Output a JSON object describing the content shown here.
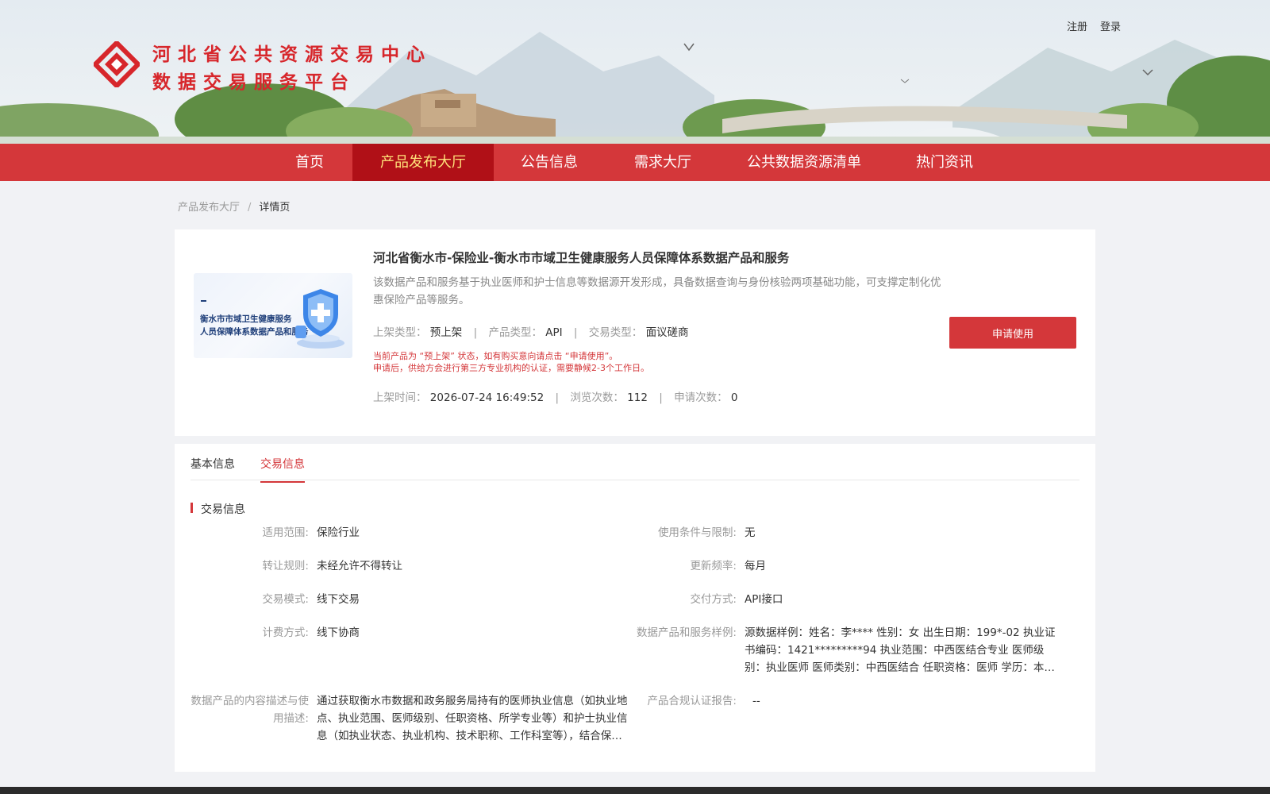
{
  "header": {
    "title_line1": "河北省公共资源交易中心",
    "title_line2": "数据交易服务平台",
    "register": "注册",
    "login": "登录",
    "colors": {
      "brand_red": "#d7262b"
    }
  },
  "nav": {
    "items": [
      {
        "label": "首页"
      },
      {
        "label": "产品发布大厅",
        "active": true
      },
      {
        "label": "公告信息"
      },
      {
        "label": "需求大厅"
      },
      {
        "label": "公共数据资源清单"
      },
      {
        "label": "热门资讯"
      }
    ]
  },
  "breadcrumb": {
    "parent": "产品发布大厅",
    "separator": "/",
    "current": "详情页"
  },
  "product": {
    "image_text_line1": "衡水市市域卫生健康服务",
    "image_text_line2": "人员保障体系数据产品和服务",
    "title": "河北省衡水市-保险业-衡水市市域卫生健康服务人员保障体系数据产品和服务",
    "description": "该数据产品和服务基于执业医师和护士信息等数据源开发形成，具备数据查询与身份核验两项基础功能，可支撑定制化优惠保险产品等服务。",
    "meta": {
      "listing_type_label": "上架类型：",
      "listing_type": "预上架",
      "product_type_label": "产品类型：",
      "product_type": "API",
      "trade_type_label": "交易类型：",
      "trade_type": "面议磋商"
    },
    "notice_line1": "当前产品为 “预上架” 状态，如有购买意向请点击 “申请使用”。",
    "notice_line2": "申请后，供给方会进行第三方专业机构的认证，需要静候2-3个工作日。",
    "stats": {
      "listed_time_label": "上架时间：",
      "listed_time": "2026-07-24 16:49:52",
      "views_label": "浏览次数：",
      "views": "112",
      "applications_label": "申请次数：",
      "applications": "0"
    },
    "apply_button": "申请使用",
    "separator": "|"
  },
  "detail": {
    "tabs": [
      {
        "label": "基本信息"
      },
      {
        "label": "交易信息",
        "active": true
      }
    ],
    "section_title": "交易信息",
    "left_fields": [
      {
        "label": "适用范围:",
        "value": "保险行业"
      },
      {
        "label": "转让规则:",
        "value": "未经允许不得转让"
      },
      {
        "label": "交易模式:",
        "value": "线下交易"
      },
      {
        "label": "计费方式:",
        "value": "线下协商"
      },
      {
        "label": "数据产品的内容描述与使用描述:",
        "value": "通过获取衡水市数据和政务服务局持有的医师执业信息（如执业地点、执业范围、医师级别、任职资格、所学专业等）和护士执业信息（如执业状态、执业机构、技术职称、工作科室等），结合保险公司需求"
      }
    ],
    "right_fields": [
      {
        "label": "使用条件与限制:",
        "value": "无"
      },
      {
        "label": "更新频率:",
        "value": "每月"
      },
      {
        "label": "交付方式:",
        "value": "API接口"
      },
      {
        "label": "数据产品和服务样例:",
        "value": "源数据样例：姓名：李**** 性别：女 出生日期：199*-02 执业证书编码：1421*********94 执业范围：中西医结合专业 医师级别：执业医师 医师类别：中西医结合 任职资格：医师 学历：本科 所学专业"
      },
      {
        "label": "产品合规认证报告:",
        "value": "--"
      }
    ]
  }
}
